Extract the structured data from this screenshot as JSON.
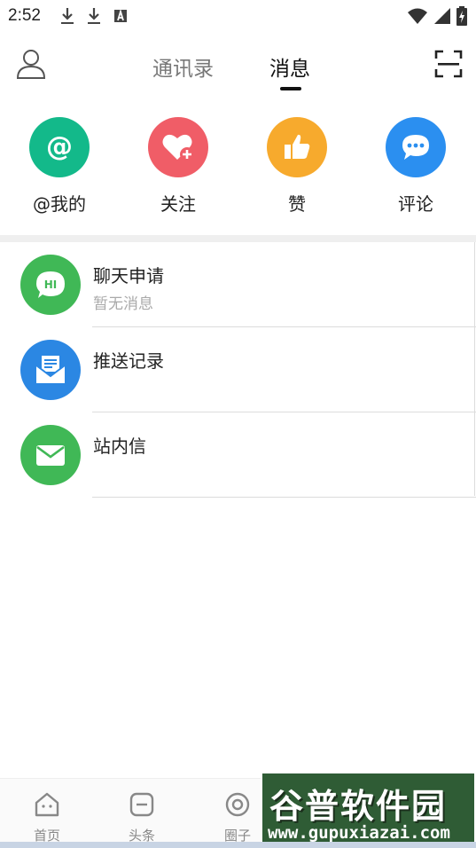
{
  "status_bar": {
    "time": "2:52",
    "left_icons": [
      "download-icon",
      "download-icon",
      "a-box-icon"
    ],
    "right_icons": [
      "wifi-icon",
      "signal-icon",
      "battery-charging-icon"
    ]
  },
  "header": {
    "profile_icon": "person-icon",
    "tabs": [
      {
        "label": "通讯录",
        "active": false
      },
      {
        "label": "消息",
        "active": true
      }
    ],
    "scan_icon": "scan-icon"
  },
  "categories": [
    {
      "label": "@我的",
      "icon": "at-icon",
      "color": "#13b98a"
    },
    {
      "label": "关注",
      "icon": "heart-plus-icon",
      "color": "#f05d67"
    },
    {
      "label": "赞",
      "icon": "thumbs-up-icon",
      "color": "#f7aa2d"
    },
    {
      "label": "评论",
      "icon": "chat-icon",
      "color": "#2b8ff0"
    }
  ],
  "messages": [
    {
      "title": "聊天申请",
      "subtitle": "暂无消息",
      "icon": "hi-bubble-icon",
      "color": "#40b856"
    },
    {
      "title": "推送记录",
      "subtitle": "",
      "icon": "envelope-open-icon",
      "color": "#2b87e3"
    },
    {
      "title": "站内信",
      "subtitle": "",
      "icon": "mail-icon",
      "color": "#40b856"
    }
  ],
  "bottom_nav": [
    {
      "label": "首页",
      "icon": "home-icon"
    },
    {
      "label": "头条",
      "icon": "news-icon"
    },
    {
      "label": "圈子",
      "icon": "circle-icon"
    }
  ],
  "watermark": {
    "title": "谷普软件园",
    "url": "www.gupuxiazai.com"
  }
}
